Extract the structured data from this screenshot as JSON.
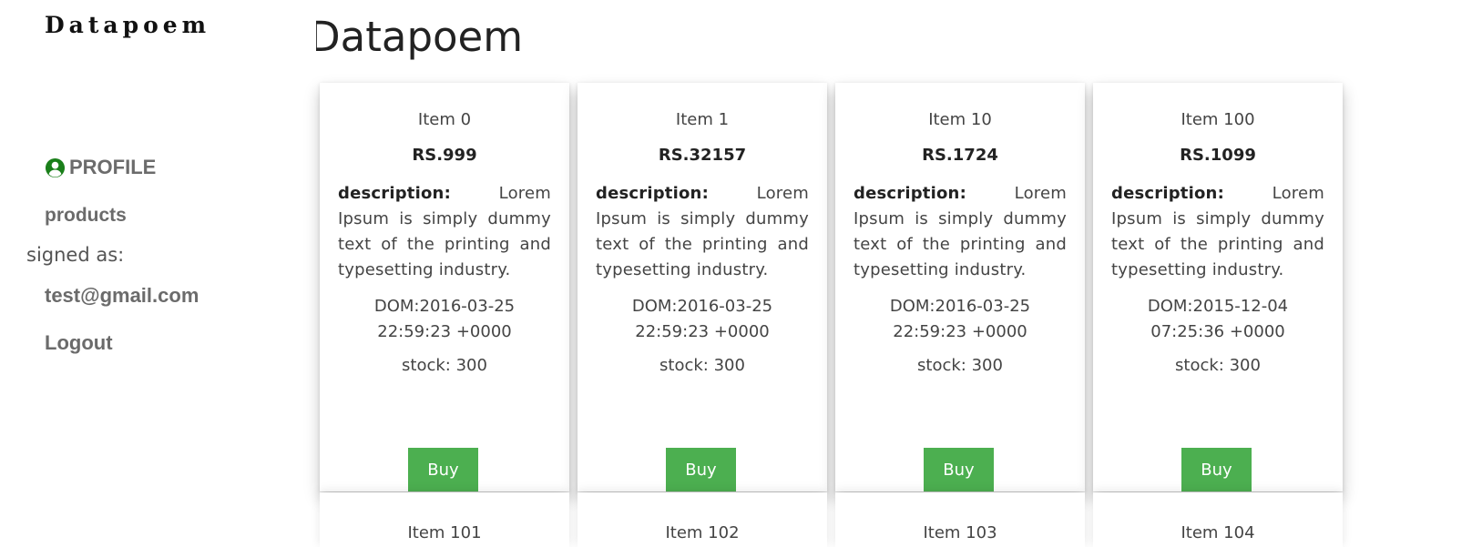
{
  "sidebar": {
    "brand": "Datapoem",
    "profile_label": "PROFILE",
    "products_label": "products",
    "signed_as_label": "signed as:",
    "user_email": "test@gmail.com",
    "logout_label": "Logout",
    "icon": "user-circle-icon",
    "profile_icon_color": "#1a7f1a"
  },
  "main": {
    "title": "Datapoem",
    "buy_button_color": "#4caf50",
    "cards": [
      {
        "name": "Item 0",
        "price": "RS.999",
        "description_label": "description:",
        "description": "Lorem Ipsum is simply dummy text of the printing and typesetting industry.",
        "dom": "DOM:2016-03-25 22:59:23 +0000",
        "stock": "stock: 300",
        "buy_label": "Buy"
      },
      {
        "name": "Item 1",
        "price": "RS.32157",
        "description_label": "description:",
        "description": "Lorem Ipsum is simply dummy text of the printing and typesetting industry.",
        "dom": "DOM:2016-03-25 22:59:23 +0000",
        "stock": "stock: 300",
        "buy_label": "Buy"
      },
      {
        "name": "Item 10",
        "price": "RS.1724",
        "description_label": "description:",
        "description": "Lorem Ipsum is simply dummy text of the printing and typesetting industry.",
        "dom": "DOM:2016-03-25 22:59:23 +0000",
        "stock": "stock: 300",
        "buy_label": "Buy"
      },
      {
        "name": "Item 100",
        "price": "RS.1099",
        "description_label": "description:",
        "description": "Lorem Ipsum is simply dummy text of the printing and typesetting industry.",
        "dom": "DOM:2015-12-04 07:25:36 +0000",
        "stock": "stock: 300",
        "buy_label": "Buy"
      }
    ],
    "next_row_peek": [
      "Item 101",
      "Item 102",
      "Item 103",
      "Item 104"
    ]
  }
}
